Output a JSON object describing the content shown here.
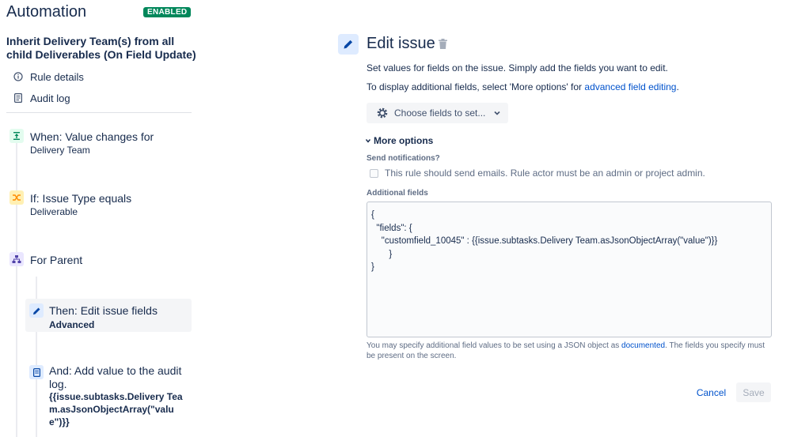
{
  "sidebar": {
    "app_title": "Automation",
    "status_badge": "ENABLED",
    "rule_name": "Inherit Delivery Team(s) from all child Deliverables (On Field Update)",
    "links": [
      {
        "label": "Rule details",
        "icon": "info-icon"
      },
      {
        "label": "Audit log",
        "icon": "document-icon"
      }
    ],
    "steps": [
      {
        "title": "When: Value changes for",
        "subtitle": "Delivery Team",
        "icon": "trigger-icon",
        "color": "#e3fcef"
      },
      {
        "title": "If: Issue Type equals",
        "subtitle": "Deliverable",
        "icon": "condition-icon",
        "color": "#fff0b3"
      },
      {
        "title": "For Parent",
        "subtitle": "",
        "icon": "branch-icon",
        "color": "#eae6ff"
      },
      {
        "title": "Then: Edit issue fields",
        "subtitle": "Advanced",
        "icon": "edit-icon",
        "color": "#deebff"
      },
      {
        "title": "And: Add value to the audit log.",
        "subtitle": "{{issue.subtasks.Delivery Team.asJsonObjectArray(\"value\")}}",
        "icon": "log-icon",
        "color": "#deebff"
      }
    ]
  },
  "main": {
    "title": "Edit issue",
    "desc1": "Set values for fields on the issue. Simply add the fields you want to edit.",
    "desc2_prefix": "To display additional fields, select 'More options' for ",
    "desc2_link": "advanced field editing",
    "desc2_suffix": ".",
    "choose_fields_label": "Choose fields to set...",
    "more_options_label": "More options",
    "send_notifications_label": "Send notifications?",
    "send_emails_checkbox_label": "This rule should send emails. Rule actor must be an admin or project admin.",
    "send_emails_checked": false,
    "additional_fields_label": "Additional fields",
    "additional_fields_value": "{\n  \"fields\": {\n    \"customfield_10045\" : {{issue.subtasks.Delivery Team.asJsonObjectArray(\"value\")}}\n       }\n}",
    "help_prefix": "You may specify additional field values to be set using a JSON object as ",
    "help_link": "documented",
    "help_suffix": ". The fields you specify must be present on the screen.",
    "cancel_label": "Cancel",
    "save_label": "Save"
  },
  "colors": {
    "accent": "#0052cc",
    "enabled_badge": "#00875a"
  }
}
